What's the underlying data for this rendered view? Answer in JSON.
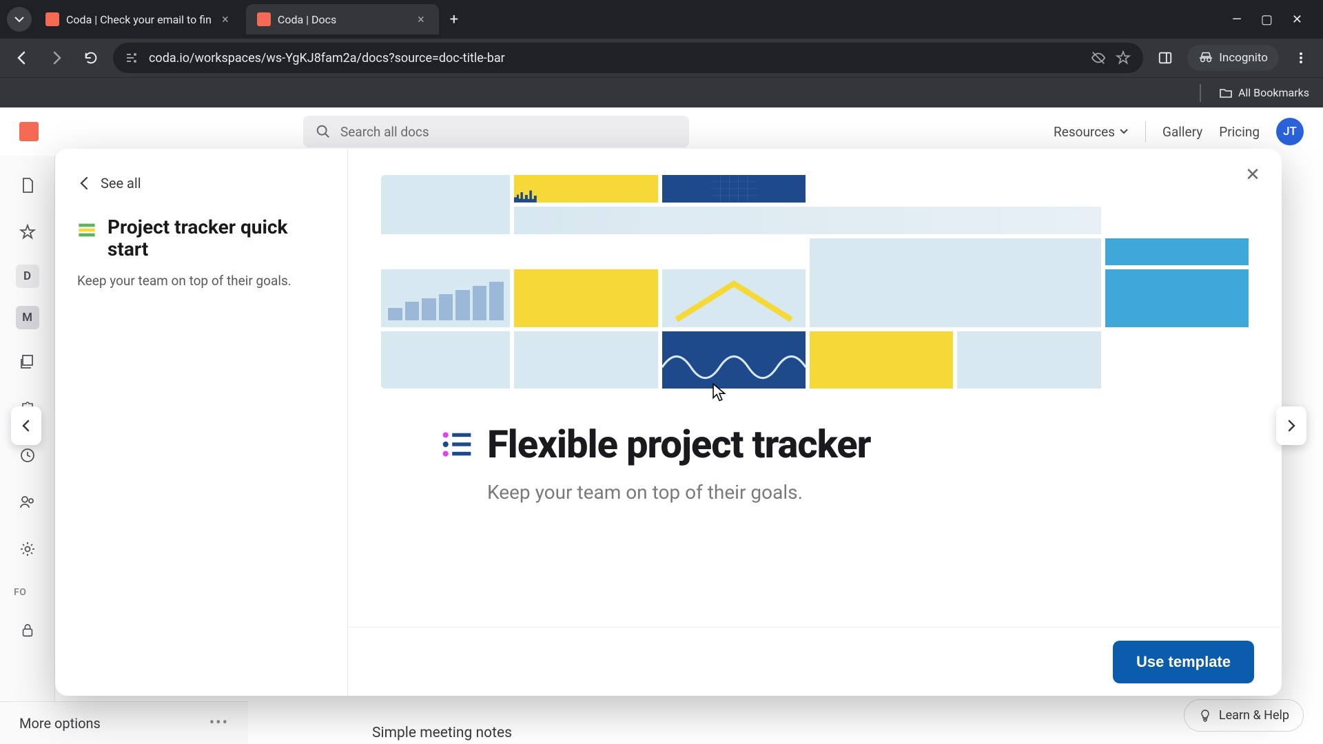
{
  "browser": {
    "tabs": [
      {
        "title": "Coda | Check your email to fin",
        "active": false
      },
      {
        "title": "Coda | Docs",
        "active": true
      }
    ],
    "url": "coda.io/workspaces/ws-YgKJ8fam2a/docs?source=doc-title-bar",
    "incognito_label": "Incognito",
    "all_bookmarks": "All Bookmarks"
  },
  "app": {
    "search_placeholder": "Search all docs",
    "header": {
      "resources": "Resources",
      "gallery": "Gallery",
      "pricing": "Pricing",
      "avatar_initials": "JT"
    },
    "rail": {
      "badge1": "D",
      "badge2": "M",
      "section_label": "FO"
    },
    "modal": {
      "see_all": "See all",
      "left_title": "Project tracker quick start",
      "left_desc": "Keep your team on top of their goals.",
      "content_title": "Flexible project tracker",
      "content_subtitle": "Keep your team on top of their goals.",
      "use_template": "Use template"
    },
    "more_options": "More options",
    "learn_help": "Learn & Help",
    "behind_doc": "Simple meeting notes"
  },
  "colors": {
    "accent": "#0b5cad",
    "coda_orange": "#f46a54",
    "hero_blue": "#1e4a8c",
    "hero_yellow": "#f5d939",
    "hero_cyan": "#3fa8d8"
  }
}
